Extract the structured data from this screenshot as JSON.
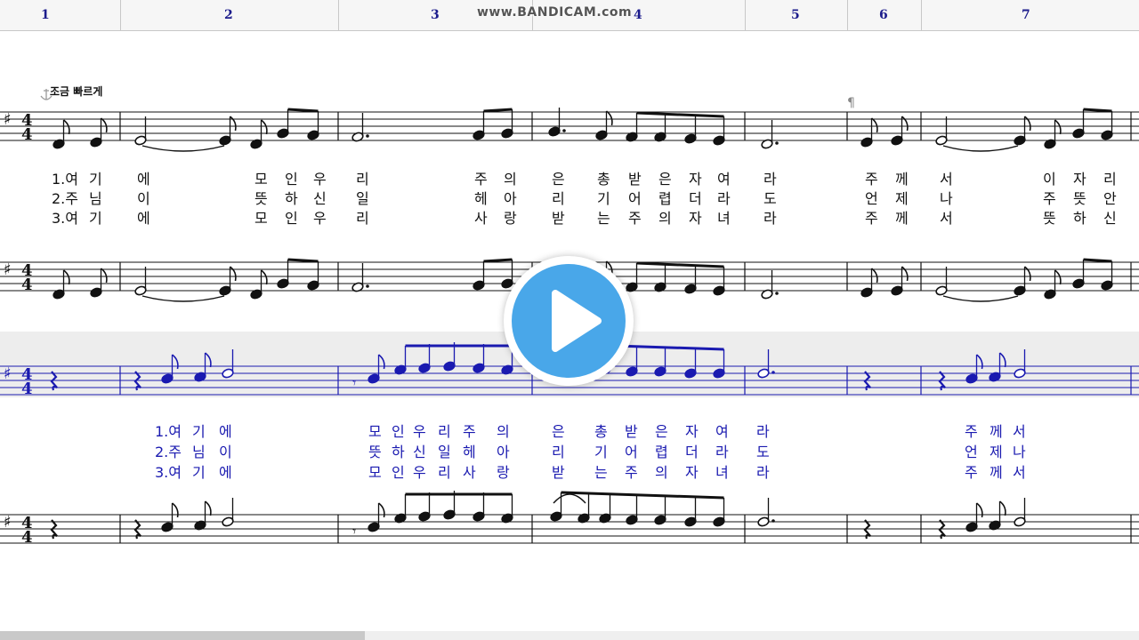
{
  "watermark": "www.BANDICAM.com",
  "ruler": {
    "measures": [
      "1",
      "2",
      "3",
      "4",
      "5",
      "6",
      "7"
    ]
  },
  "tempo": "조금 빠르게",
  "paragraph_mark": "¶",
  "time_signature": {
    "top": "4",
    "bottom": "4"
  },
  "key_signature": "♯",
  "upper_lyrics": [
    [
      "1.여",
      "기",
      "에",
      "모",
      "인",
      "우",
      "리",
      "주",
      "의",
      "은",
      "총",
      "받",
      "은",
      "자",
      "여",
      "라",
      "주",
      "께",
      "서",
      "이",
      "자",
      "리"
    ],
    [
      "2.주",
      "님",
      "이",
      "뜻",
      "하",
      "신",
      "일",
      "헤",
      "아",
      "리",
      "기",
      "어",
      "렵",
      "더",
      "라",
      "도",
      "언",
      "제",
      "나",
      "주",
      "뜻",
      "안"
    ],
    [
      "3.여",
      "기",
      "에",
      "모",
      "인",
      "우",
      "리",
      "사",
      "랑",
      "받",
      "는",
      "주",
      "의",
      "자",
      "녀",
      "라",
      "주",
      "께",
      "서",
      "뜻",
      "하",
      "신"
    ]
  ],
  "lower_lyrics": [
    [
      "1.여",
      "기",
      "에",
      "모",
      "인",
      "우",
      "리",
      "주",
      "의",
      "은",
      "총",
      "받",
      "은",
      "자",
      "여",
      "라",
      "주",
      "께",
      "서"
    ],
    [
      "2.주",
      "님",
      "이",
      "뜻",
      "하",
      "신",
      "일",
      "헤",
      "아",
      "리",
      "기",
      "어",
      "렵",
      "더",
      "라",
      "도",
      "언",
      "제",
      "나"
    ],
    [
      "3.여",
      "기",
      "에",
      "모",
      "인",
      "우",
      "리",
      "사",
      "랑",
      "받",
      "는",
      "주",
      "의",
      "자",
      "녀",
      "라",
      "주",
      "께",
      "서"
    ]
  ],
  "colors": {
    "staff_black": "#111111",
    "staff_blue": "#1a1ab0",
    "band_gray": "#ededed",
    "play_blue": "#49a7e9"
  },
  "icons": {
    "play": "play-icon",
    "anchor": "anchor-icon"
  },
  "scrollbar": {
    "position_fraction": 0.0,
    "visible_fraction": 0.32
  }
}
